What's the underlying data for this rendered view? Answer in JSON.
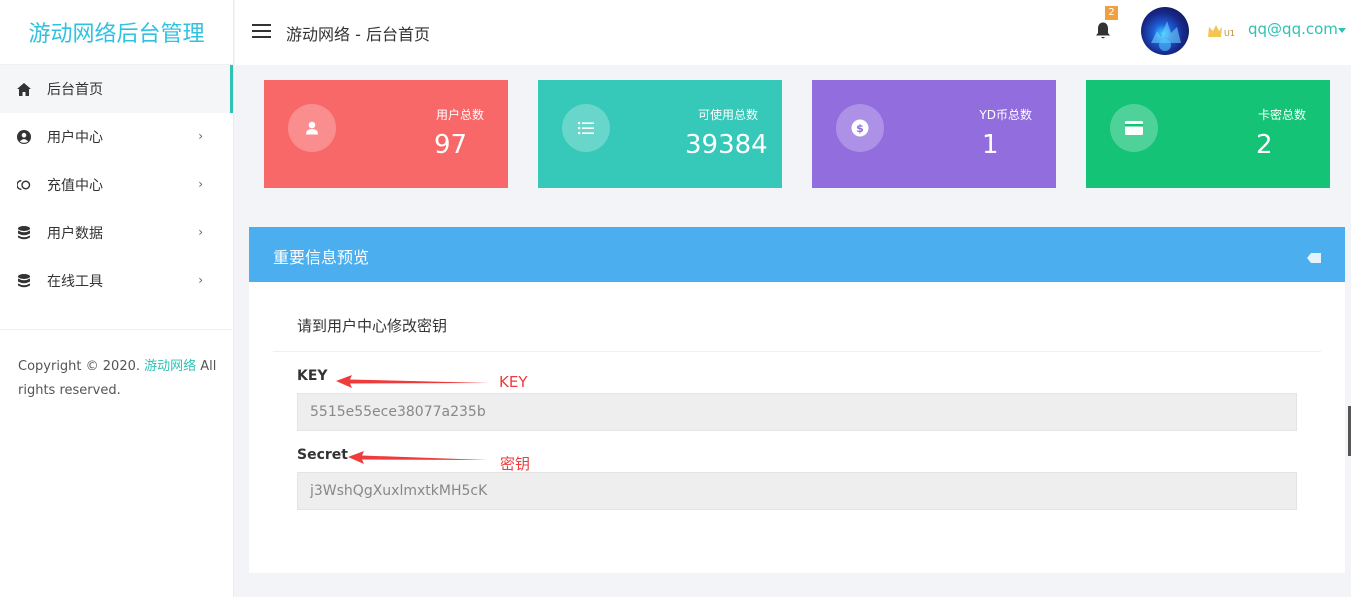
{
  "sidebar": {
    "brand": "游动网络后台管理",
    "items": [
      {
        "label": "后台首页",
        "active": true,
        "icon": "home-icon"
      },
      {
        "label": "用户中心",
        "arrow": "›",
        "icon": "user-circle-icon"
      },
      {
        "label": "充值中心",
        "arrow": "›",
        "icon": "recharge-icon"
      },
      {
        "label": "用户数据",
        "arrow": "›",
        "icon": "database-icon"
      },
      {
        "label": "在线工具",
        "arrow": "›",
        "icon": "tools-icon"
      }
    ],
    "copyright_prefix": "Copyright © 2020. ",
    "copyright_link": "游动网络",
    "copyright_suffix": " All rights reserved."
  },
  "header": {
    "breadcrumb": "游动网络 - 后台首页",
    "notification_count": "2",
    "user_level": "U1",
    "user_email": "qq@qq.com"
  },
  "cards": [
    {
      "label": "用户总数",
      "value": "97",
      "color": "#f96868",
      "icon": "user-icon"
    },
    {
      "label": "可使用总数",
      "value": "39384",
      "color": "#36c8b8",
      "icon": "list-icon"
    },
    {
      "label": "YD币总数",
      "value": "1",
      "color": "#926dde",
      "icon": "coin-icon"
    },
    {
      "label": "卡密总数",
      "value": "2",
      "color": "#15c377",
      "icon": "card-icon"
    }
  ],
  "panel": {
    "title": "重要信息预览",
    "notice": "请到用户中心修改密钥",
    "key_label": "KEY",
    "key_value": "5515e55ece38077a235b",
    "key_annotation": "KEY",
    "secret_label": "Secret",
    "secret_value": "j3WshQgXuxlmxtkMH5cK",
    "secret_annotation": "密钥"
  },
  "colors": {
    "accent": "#2fc2b5",
    "brand": "#2fc2e0",
    "panel_header": "#4aaeef",
    "annotation": "#ee3b3b"
  }
}
